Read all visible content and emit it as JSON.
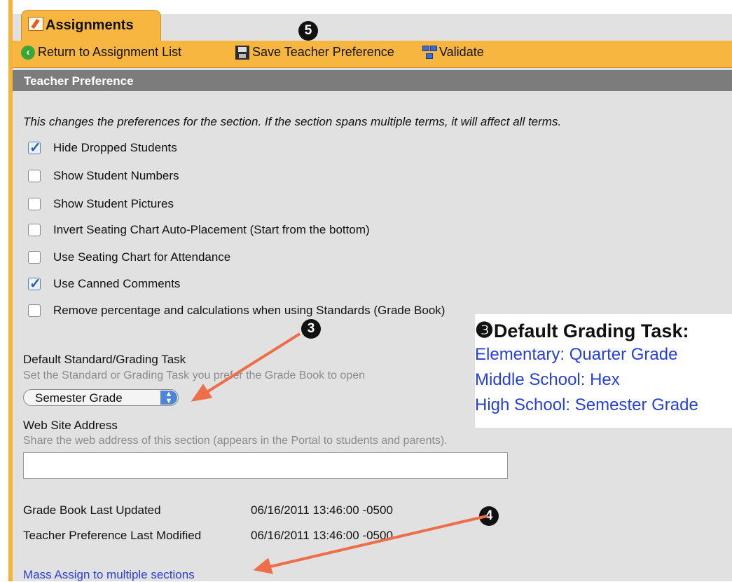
{
  "tab": {
    "label": "Assignments"
  },
  "toolbar": {
    "return_label": "Return to Assignment List",
    "save_label": "Save Teacher Preference",
    "validate_label": "Validate"
  },
  "section": {
    "title": "Teacher Preference"
  },
  "intro": "This changes the preferences for the section. If the section spans multiple terms, it will affect all terms.",
  "preferences": [
    {
      "label": "Hide Dropped Students",
      "checked": true
    },
    {
      "label": "Show Student Numbers",
      "checked": false
    },
    {
      "label": "Show Student Pictures",
      "checked": false
    },
    {
      "label": "Invert Seating Chart Auto-Placement (Start from the bottom)",
      "checked": false
    },
    {
      "label": "Use Seating Chart for Attendance",
      "checked": false
    },
    {
      "label": "Use Canned Comments",
      "checked": true
    },
    {
      "label": "Remove percentage and calculations when using Standards (Grade Book)",
      "checked": false
    }
  ],
  "default_task": {
    "label": "Default Standard/Grading Task",
    "hint": "Set the Standard or Grading Task you prefer the Grade Book to open",
    "selected": "Semester Grade"
  },
  "website": {
    "label": "Web Site Address",
    "hint": "Share the web address of this section (appears in the Portal to students and parents).",
    "value": ""
  },
  "meta": {
    "gradebook_label": "Grade Book Last Updated",
    "gradebook_value": "06/16/2011 13:46:00 -0500",
    "pref_label": "Teacher Preference Last Modified",
    "pref_value": "06/16/2011 13:46:00 -0500"
  },
  "link": {
    "mass_assign": "Mass Assign to multiple sections"
  },
  "callout": {
    "title": "Default Grading Task:",
    "lines": [
      "Elementary:  Quarter Grade",
      "Middle School:  Hex",
      "High School:  Semester Grade"
    ]
  },
  "badges": {
    "b3": "3",
    "b4": "4",
    "b5": "5"
  },
  "colors": {
    "accent": "#f7b63f",
    "arrow": "#ee6e4a",
    "link": "#2b3fd1"
  }
}
